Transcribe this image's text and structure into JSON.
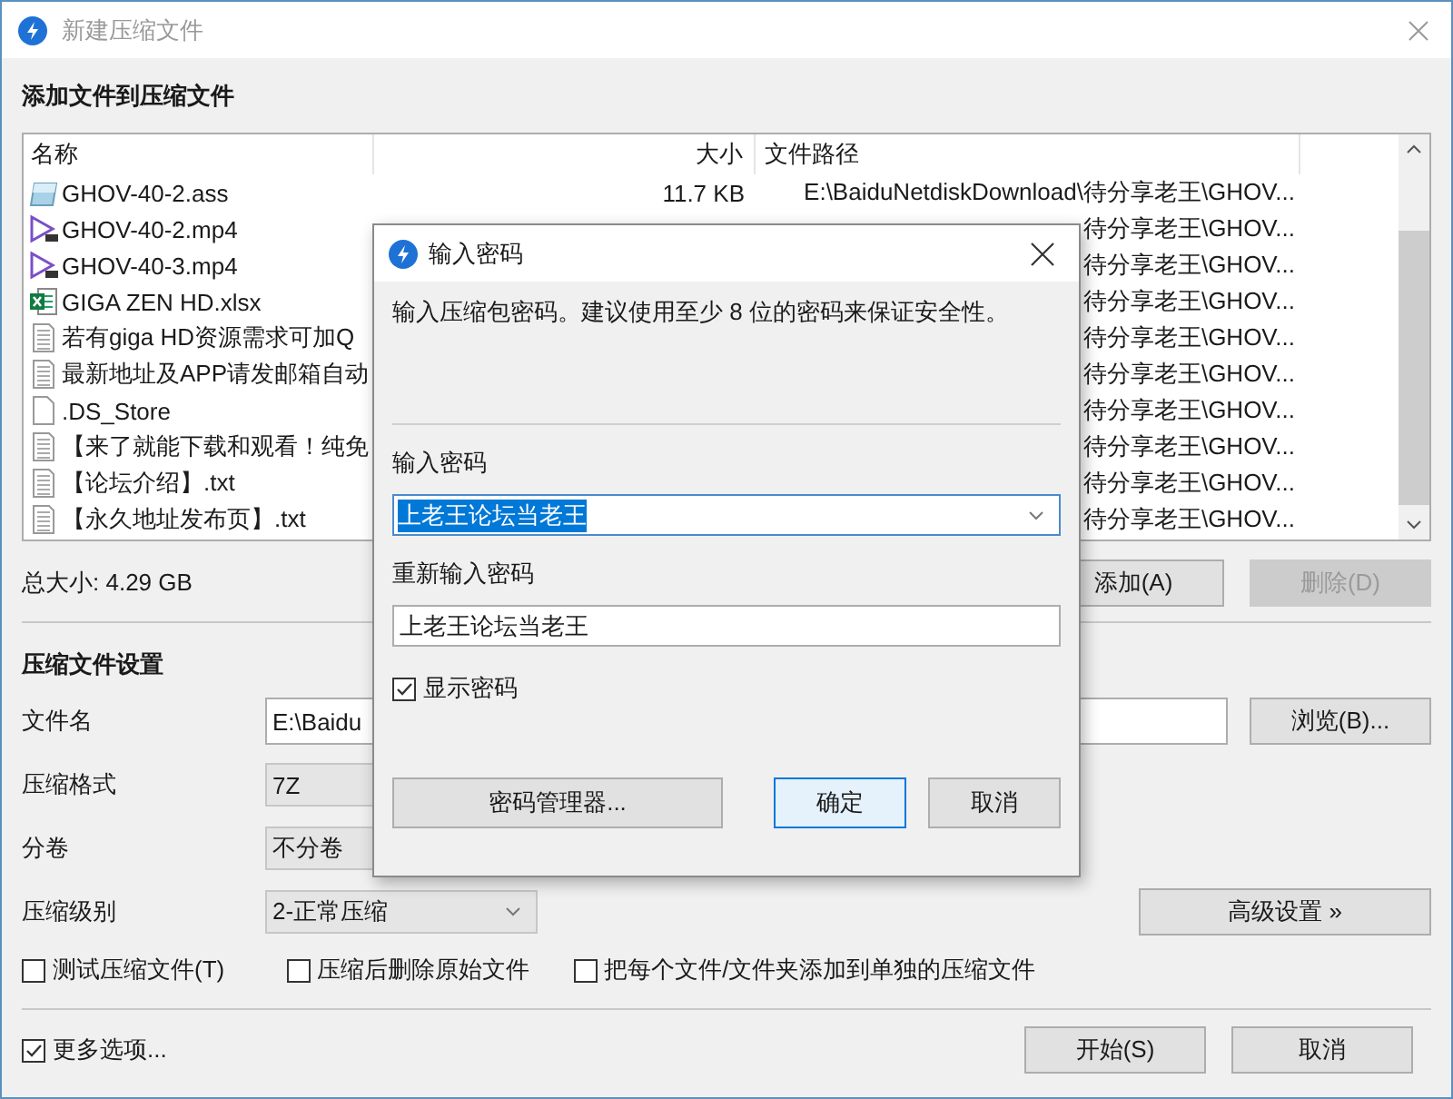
{
  "window": {
    "title": "新建压缩文件"
  },
  "files_section": {
    "title": "添加文件到压缩文件",
    "columns": [
      "名称",
      "大小",
      "文件路径"
    ],
    "rows": [
      {
        "kind": "subtitle",
        "name": "GHOV-40-2.ass",
        "size": "11.7 KB",
        "path": "E:\\BaiduNetdiskDownload\\待分享老王\\GHOV..."
      },
      {
        "kind": "video",
        "name": "GHOV-40-2.mp4",
        "path": "待分享老王\\GHOV..."
      },
      {
        "kind": "video",
        "name": "GHOV-40-3.mp4",
        "path": "待分享老王\\GHOV..."
      },
      {
        "kind": "excel",
        "name": "GIGA ZEN HD.xlsx",
        "path": "待分享老王\\GHOV..."
      },
      {
        "kind": "text",
        "name": "若有giga HD资源需求可加Q",
        "path": "待分享老王\\GHOV..."
      },
      {
        "kind": "text",
        "name": "最新地址及APP请发邮箱自动",
        "path": "待分享老王\\GHOV..."
      },
      {
        "kind": "blank",
        "name": ".DS_Store",
        "path": "待分享老王\\GHOV..."
      },
      {
        "kind": "text",
        "name": "【来了就能下载和观看！纯免",
        "path": "待分享老王\\GHOV..."
      },
      {
        "kind": "text",
        "name": "【论坛介绍】.txt",
        "path": "待分享老王\\GHOV..."
      },
      {
        "kind": "text",
        "name": "【永久地址发布页】.txt",
        "path": "待分享老王\\GHOV..."
      }
    ],
    "total": "总大小: 4.29 GB",
    "buttons": [
      {
        "label": "添加(A)",
        "disabled": false
      },
      {
        "label": "删除(D)",
        "disabled": true
      }
    ]
  },
  "settings": {
    "title": "压缩文件设置",
    "fields": [
      {
        "kind": "text",
        "label": "文件名",
        "value": "E:\\Baidu"
      },
      {
        "kind": "select",
        "label": "压缩格式",
        "value": "7Z"
      },
      {
        "kind": "select",
        "label": "分卷",
        "value": "不分卷"
      },
      {
        "kind": "dropdown",
        "label": "压缩级别",
        "value": "2-正常压缩"
      }
    ],
    "browse_button": "浏览(B)...",
    "advanced_button": "高级设置 »",
    "options": [
      {
        "label": "测试压缩文件(T)",
        "checked": false
      },
      {
        "label": "压缩后删除原始文件",
        "checked": false
      },
      {
        "label": "把每个文件/文件夹添加到单独的压缩文件",
        "checked": false
      }
    ]
  },
  "footer": {
    "more_options": {
      "label": "更多选项...",
      "checked": true
    },
    "buttons": [
      "开始(S)",
      "取消"
    ]
  },
  "password_dialog": {
    "title": "输入密码",
    "hint": "输入压缩包密码。建议使用至少 8 位的密码来保证安全性。",
    "password_label": "输入密码",
    "password": "上老王论坛当老王",
    "password_selected": true,
    "confirm_label": "重新输入密码",
    "confirm": "上老王论坛当老王",
    "show_password": {
      "label": "显示密码",
      "checked": true
    },
    "manager_button": "密码管理器...",
    "buttons": [
      {
        "label": "确定",
        "default": true
      },
      {
        "label": "取消",
        "default": false
      }
    ]
  }
}
